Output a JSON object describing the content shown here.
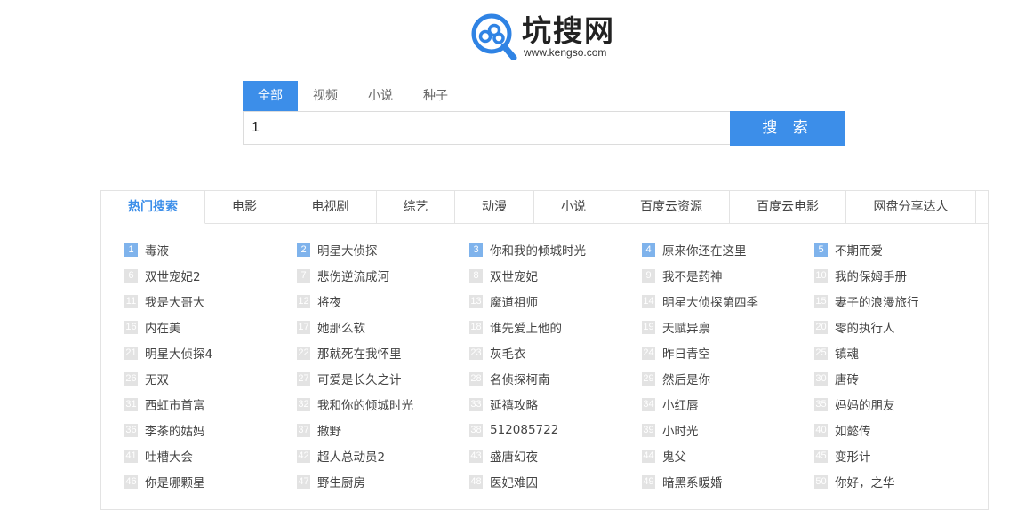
{
  "logo": {
    "name": "坑搜网",
    "url": "www.kengso.com"
  },
  "search_tabs": [
    "全部",
    "视频",
    "小说",
    "种子"
  ],
  "search": {
    "value": "1",
    "button_label": "搜 索"
  },
  "colors": {
    "accent": "#3c8ee9",
    "rank_top": "#7fb3ec",
    "rank_other": "#e3e3e3"
  },
  "category_tabs": [
    "热门搜索",
    "电影",
    "电视剧",
    "综艺",
    "动漫",
    "小说",
    "百度云资源",
    "百度云电影",
    "网盘分享达人"
  ],
  "hot_list": [
    {
      "rank": "1",
      "title": "毒液"
    },
    {
      "rank": "2",
      "title": "明星大侦探"
    },
    {
      "rank": "3",
      "title": "你和我的倾城时光"
    },
    {
      "rank": "4",
      "title": "原来你还在这里"
    },
    {
      "rank": "5",
      "title": "不期而爱"
    },
    {
      "rank": "6",
      "title": "双世宠妃2"
    },
    {
      "rank": "7",
      "title": "悲伤逆流成河"
    },
    {
      "rank": "8",
      "title": "双世宠妃"
    },
    {
      "rank": "9",
      "title": "我不是药神"
    },
    {
      "rank": "10",
      "title": "我的保姆手册"
    },
    {
      "rank": "11",
      "title": "我是大哥大"
    },
    {
      "rank": "12",
      "title": "将夜"
    },
    {
      "rank": "13",
      "title": "魔道祖师"
    },
    {
      "rank": "14",
      "title": "明星大侦探第四季"
    },
    {
      "rank": "15",
      "title": "妻子的浪漫旅行"
    },
    {
      "rank": "16",
      "title": "内在美"
    },
    {
      "rank": "17",
      "title": "她那么软"
    },
    {
      "rank": "18",
      "title": "谁先爱上他的"
    },
    {
      "rank": "19",
      "title": "天赋异禀"
    },
    {
      "rank": "20",
      "title": "零的执行人"
    },
    {
      "rank": "21",
      "title": "明星大侦探4"
    },
    {
      "rank": "22",
      "title": "那就死在我怀里"
    },
    {
      "rank": "23",
      "title": "灰毛衣"
    },
    {
      "rank": "24",
      "title": "昨日青空"
    },
    {
      "rank": "25",
      "title": "镇魂"
    },
    {
      "rank": "26",
      "title": "无双"
    },
    {
      "rank": "27",
      "title": "可爱是长久之计"
    },
    {
      "rank": "28",
      "title": "名侦探柯南"
    },
    {
      "rank": "29",
      "title": "然后是你"
    },
    {
      "rank": "30",
      "title": "唐砖"
    },
    {
      "rank": "31",
      "title": "西虹市首富"
    },
    {
      "rank": "32",
      "title": "我和你的倾城时光"
    },
    {
      "rank": "33",
      "title": "延禧攻略"
    },
    {
      "rank": "34",
      "title": "小红唇"
    },
    {
      "rank": "35",
      "title": "妈妈的朋友"
    },
    {
      "rank": "36",
      "title": "李茶的姑妈"
    },
    {
      "rank": "37",
      "title": "撒野"
    },
    {
      "rank": "38",
      "title": "512085722"
    },
    {
      "rank": "39",
      "title": "小时光"
    },
    {
      "rank": "40",
      "title": "如懿传"
    },
    {
      "rank": "41",
      "title": "吐槽大会"
    },
    {
      "rank": "42",
      "title": "超人总动员2"
    },
    {
      "rank": "43",
      "title": "盛唐幻夜"
    },
    {
      "rank": "44",
      "title": "鬼父"
    },
    {
      "rank": "45",
      "title": "变形计"
    },
    {
      "rank": "46",
      "title": "你是哪颗星"
    },
    {
      "rank": "47",
      "title": "野生厨房"
    },
    {
      "rank": "48",
      "title": "医妃难囚"
    },
    {
      "rank": "49",
      "title": "暗黑系暖婚"
    },
    {
      "rank": "50",
      "title": "你好，之华"
    }
  ]
}
